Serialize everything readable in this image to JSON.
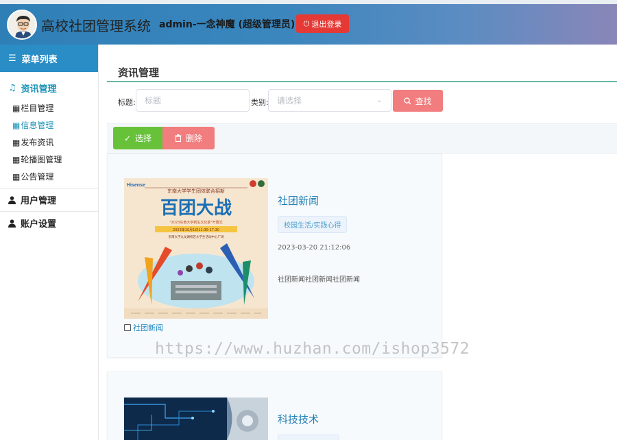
{
  "header": {
    "title": "高校社团管理系统",
    "user": "admin-一念神魔 (超级管理员)",
    "logout_label": "退出登录",
    "bg_start": "#2f7fb7",
    "bg_end": "#8a86b8"
  },
  "sidebar": {
    "menu_header": "菜单列表",
    "groups": [
      {
        "label": "资讯管理",
        "icon": "music-note-icon",
        "active": true,
        "items": [
          {
            "label": "栏目管理",
            "icon": "calendar-icon"
          },
          {
            "label": "信息管理",
            "icon": "calendar-icon",
            "current": true
          },
          {
            "label": "发布资讯",
            "icon": "calendar-icon"
          },
          {
            "label": "轮播图管理",
            "icon": "calendar-icon"
          },
          {
            "label": "公告管理",
            "icon": "calendar-icon"
          }
        ]
      },
      {
        "label": "用户管理",
        "icon": "user-icon"
      },
      {
        "label": "账户设置",
        "icon": "user-icon"
      }
    ]
  },
  "main": {
    "section_title": "资讯管理",
    "filter": {
      "title_label": "标题:",
      "title_placeholder": "标题",
      "category_label": "类别:",
      "category_placeholder": "请选择",
      "search_label": "查找"
    },
    "actions": {
      "select_label": "选择",
      "delete_label": "删除"
    },
    "news": [
      {
        "title": "社团新闻",
        "tag": "校园生活/实践心得",
        "time": "2023-03-20 21:12:06",
        "summary": "社团新闻社团新闻社团新闻",
        "checkbox_label": "社团新闻",
        "poster": {
          "brand": "Hisense",
          "heading": "东南大学学生团体联合招新",
          "big_text": "百团大战",
          "subtitle": "\"2023东南大学新生文化季\"开幕式",
          "date": "2023年10月1日11:30-17:30",
          "place": "东南大学九龙湖校区大学生活动中心广场"
        }
      },
      {
        "title": "科技技术",
        "tag": ""
      }
    ]
  },
  "watermark": "https://www.huzhan.com/ishop3572"
}
